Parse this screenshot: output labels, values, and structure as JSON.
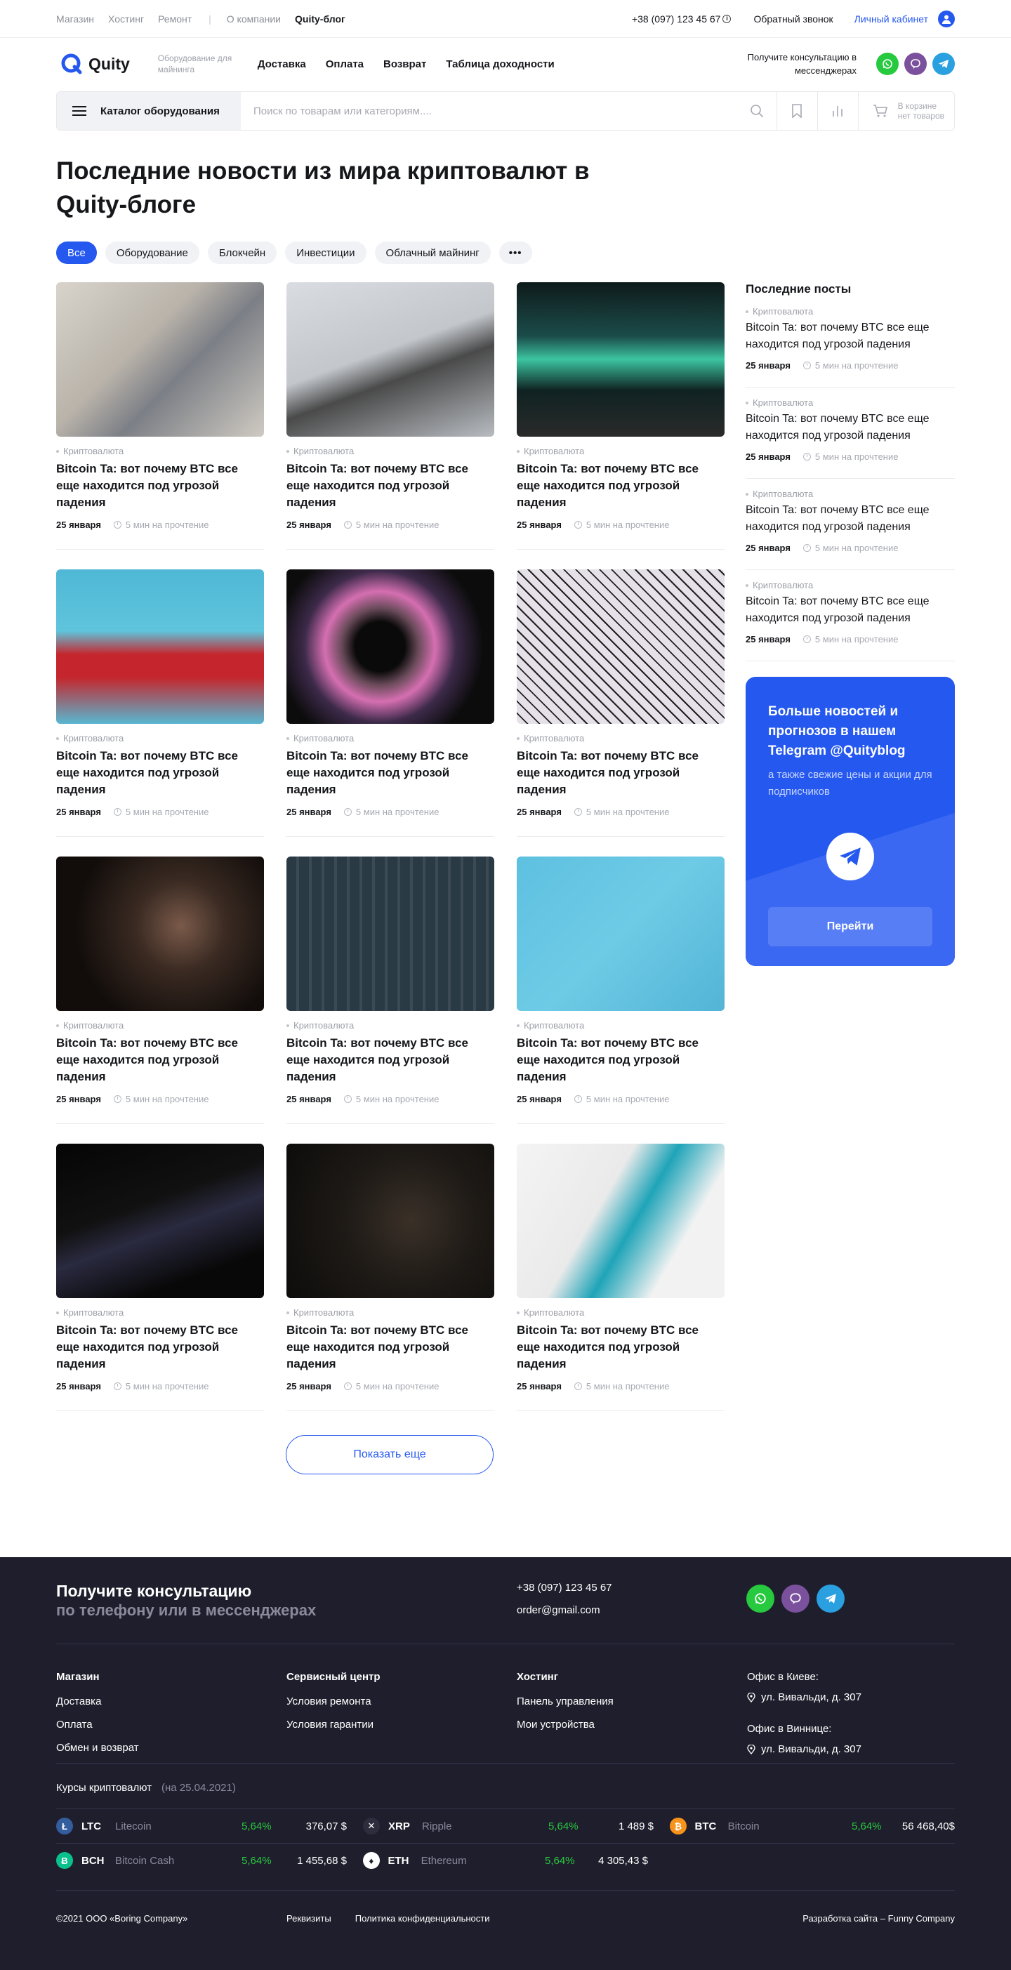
{
  "topbar": {
    "links": [
      "Магазин",
      "Хостинг",
      "Ремонт"
    ],
    "separator": "|",
    "links2": [
      "О компании"
    ],
    "active": "Quity-блог",
    "phone": "+38 (097) 123 45 67",
    "callback": "Обратный звонок",
    "cabinet": "Личный кабинет"
  },
  "header": {
    "logo": "Quity",
    "tagline": "Оборудование для майнинга",
    "nav": [
      "Доставка",
      "Оплата",
      "Возврат",
      "Таблица доходности"
    ],
    "consult": "Получите консультацию в мессенджерах"
  },
  "searchbar": {
    "catalog": "Каталог оборудования",
    "placeholder": "Поиск по товарам или категориям....",
    "cart_line1": "В корзине",
    "cart_line2": "нет товаров"
  },
  "page": {
    "title": "Последние новости из мира криптовалют в Quity-блоге",
    "filters": [
      "Все",
      "Оборудование",
      "Блокчейн",
      "Инвестиции",
      "Облачный майнинг"
    ],
    "more": "•••",
    "show_more": "Показать еще"
  },
  "cards": [
    {
      "category": "Криптовалюта",
      "title": "Bitcoin Ta: вот почему BTC все еще находится под угрозой падения",
      "date": "25 января",
      "read": "5 мин на прочтение"
    },
    {
      "category": "Криптовалюта",
      "title": "Bitcoin Ta: вот почему BTC все еще находится под угрозой падения",
      "date": "25 января",
      "read": "5 мин на прочтение"
    },
    {
      "category": "Криптовалюта",
      "title": "Bitcoin Ta: вот почему BTC все еще находится под угрозой падения",
      "date": "25 января",
      "read": "5 мин на прочтение"
    },
    {
      "category": "Криптовалюта",
      "title": "Bitcoin Ta: вот почему BTC все еще находится под угрозой падения",
      "date": "25 января",
      "read": "5 мин на прочтение"
    },
    {
      "category": "Криптовалюта",
      "title": "Bitcoin Ta: вот почему BTC все еще находится под угрозой падения",
      "date": "25 января",
      "read": "5 мин на прочтение"
    },
    {
      "category": "Криптовалюта",
      "title": "Bitcoin Ta: вот почему BTC все еще находится под угрозой падения",
      "date": "25 января",
      "read": "5 мин на прочтение"
    },
    {
      "category": "Криптовалюта",
      "title": "Bitcoin Ta: вот почему BTC все еще находится под угрозой падения",
      "date": "25 января",
      "read": "5 мин на прочтение"
    },
    {
      "category": "Криптовалюта",
      "title": "Bitcoin Ta: вот почему BTC все еще находится под угрозой падения",
      "date": "25 января",
      "read": "5 мин на прочтение"
    },
    {
      "category": "Криптовалюта",
      "title": "Bitcoin Ta: вот почему BTC все еще находится под угрозой падения",
      "date": "25 января",
      "read": "5 мин на прочтение"
    },
    {
      "category": "Криптовалюта",
      "title": "Bitcoin Ta: вот почему BTC все еще находится под угрозой падения",
      "date": "25 января",
      "read": "5 мин на прочтение"
    },
    {
      "category": "Криптовалюта",
      "title": "Bitcoin Ta: вот почему BTC все еще находится под угрозой падения",
      "date": "25 января",
      "read": "5 мин на прочтение"
    },
    {
      "category": "Криптовалюта",
      "title": "Bitcoin Ta: вот почему BTC все еще находится под угрозой падения",
      "date": "25 января",
      "read": "5 мин на прочтение"
    }
  ],
  "sidebar": {
    "title": "Последние посты",
    "posts": [
      {
        "category": "Криптовалюта",
        "title": "Bitcoin Ta: вот почему BTC все еще находится под угрозой падения",
        "date": "25 января",
        "read": "5 мин на прочтение"
      },
      {
        "category": "Криптовалюта",
        "title": "Bitcoin Ta: вот почему BTC все еще находится под угрозой падения",
        "date": "25 января",
        "read": "5 мин на прочтение"
      },
      {
        "category": "Криптовалюта",
        "title": "Bitcoin Ta: вот почему BTC все еще находится под угрозой падения",
        "date": "25 января",
        "read": "5 мин на прочтение"
      },
      {
        "category": "Криптовалюта",
        "title": "Bitcoin Ta: вот почему BTC все еще находится под угрозой падения",
        "date": "25 января",
        "read": "5 мин на прочтение"
      }
    ],
    "promo_title": "Больше новостей и прогнозов в нашем Telegram @Quityblog",
    "promo_text": "а также свежие цены и акции для подписчиков",
    "promo_button": "Перейти"
  },
  "footer": {
    "consult_title": "Получите консультацию",
    "consult_sub": "по телефону или в мессенджерах",
    "phone": "+38 (097) 123 45 67",
    "email": "order@gmail.com",
    "shop_title": "Магазин",
    "shop_links": [
      "Доставка",
      "Оплата",
      "Обмен и возврат"
    ],
    "service_title": "Сервисный центр",
    "service_links": [
      "Условия ремонта",
      "Условия гарантии"
    ],
    "hosting_title": "Хостинг",
    "hosting_links": [
      "Панель управления",
      "Мои устройства"
    ],
    "office1": "Офис в Киеве:",
    "office1_addr": "ул.  Вивальди, д. 307",
    "office2": "Офис в Виннице:",
    "office2_addr": "ул.  Вивальди, д. 307",
    "rates_title": "Курсы криптовалют",
    "rates_date": "(на 25.04.2021)",
    "rates": [
      {
        "sym": "LTC",
        "name": "Litecoin",
        "pct": "5,64%",
        "price": "376,07 $",
        "color": "#345d9d",
        "glyph": "Ł"
      },
      {
        "sym": "XRP",
        "name": "Ripple",
        "pct": "5,64%",
        "price": "1 489 $",
        "color": "#2e2d3d",
        "glyph": "✕"
      },
      {
        "sym": "BTC",
        "name": "Bitcoin",
        "pct": "5,64%",
        "price": "56 468,40$",
        "color": "#f7931a",
        "glyph": "₿"
      },
      {
        "sym": "BCH",
        "name": "Bitcoin Cash",
        "pct": "5,64%",
        "price": "1 455,68 $",
        "color": "#0ac18e",
        "glyph": "Ƀ"
      },
      {
        "sym": "ETH",
        "name": "Ethereum",
        "pct": "5,64%",
        "price": "4 305,43 $",
        "color": "#ffffff",
        "glyph": "♦"
      }
    ],
    "copyright": "©2021 ООО «Boring Company»",
    "requisites": "Реквизиты",
    "privacy": "Политика конфиденциальности",
    "developer": "Разработка сайта – Funny Company"
  },
  "colors": {
    "accent": "#2458ef",
    "footer_bg": "#1f1e2c",
    "positive": "#27c93f"
  }
}
